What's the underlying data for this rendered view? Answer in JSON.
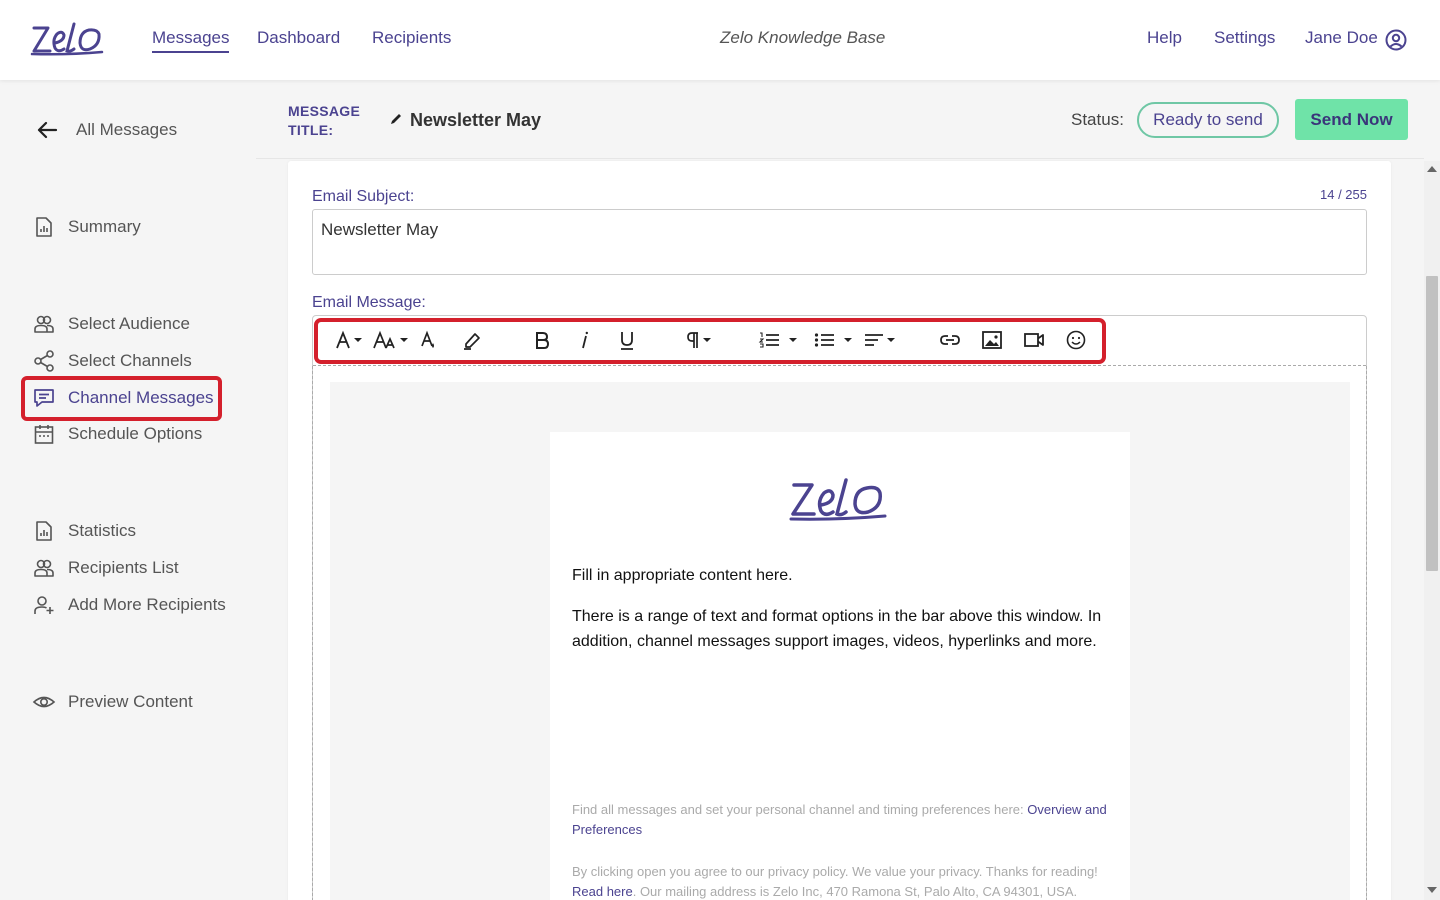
{
  "header": {
    "logo_text": "Zelo",
    "nav": [
      "Messages",
      "Dashboard",
      "Recipients"
    ],
    "knowledge_base": "Zelo Knowledge Base",
    "help": "Help",
    "settings": "Settings",
    "user_name": "Jane Doe"
  },
  "sidebar": {
    "back_label": "All Messages",
    "items": [
      {
        "label": "Summary",
        "icon": "report-icon"
      },
      {
        "label": "Select Audience",
        "icon": "users-icon"
      },
      {
        "label": "Select Channels",
        "icon": "share-icon"
      },
      {
        "label": "Channel Messages",
        "icon": "message-icon"
      },
      {
        "label": "Schedule Options",
        "icon": "calendar-icon"
      },
      {
        "label": "Statistics",
        "icon": "report-icon"
      },
      {
        "label": "Recipients List",
        "icon": "users-icon"
      },
      {
        "label": "Add More Recipients",
        "icon": "user-plus-icon"
      },
      {
        "label": "Preview Content",
        "icon": "eye-icon"
      }
    ],
    "active_item": "Channel Messages"
  },
  "title_bar": {
    "label": "MESSAGE TITLE:",
    "label_line1": "MESSAGE",
    "label_line2": "TITLE:",
    "title": "Newsletter May",
    "status_label": "Status:",
    "status_value": "Ready to send",
    "send_button": "Send Now"
  },
  "editor": {
    "subject_label": "Email Subject:",
    "subject_value": "Newsletter May",
    "subject_counter": "14 / 255",
    "message_label": "Email Message:",
    "toolbar": [
      "font-color-icon",
      "font-size-icon",
      "text-color-icon",
      "highlight-icon",
      "bold-icon",
      "italic-icon",
      "underline-icon",
      "paragraph-icon",
      "ordered-list-icon",
      "unordered-list-icon",
      "align-icon",
      "link-icon",
      "image-icon",
      "video-icon",
      "emoji-icon"
    ],
    "email": {
      "logo_text": "Zelo",
      "paragraph1": "Fill in appropriate content here.",
      "paragraph2_line1": "There is a range of text and format options in the bar above this window. In",
      "paragraph2_line2": "addition, channel messages support images, videos, hyperlinks and more.",
      "footer1_text": "Find all messages and set your personal channel and timing preferences here: ",
      "footer1_link": "Overview and Preferences",
      "footer2_line1": "By clicking open you agree to our privacy policy. We value your privacy. Thanks for reading!",
      "footer2_link": "Read here",
      "footer2_rest": ". Our mailing address is Zelo Inc, 470 Ramona St, Palo Alto, CA 94301, USA."
    }
  },
  "colors": {
    "brand": "#4b4390",
    "accent_green": "#6fe3a8",
    "status_border": "#6fc7a5",
    "highlight_red": "#d4202c"
  }
}
